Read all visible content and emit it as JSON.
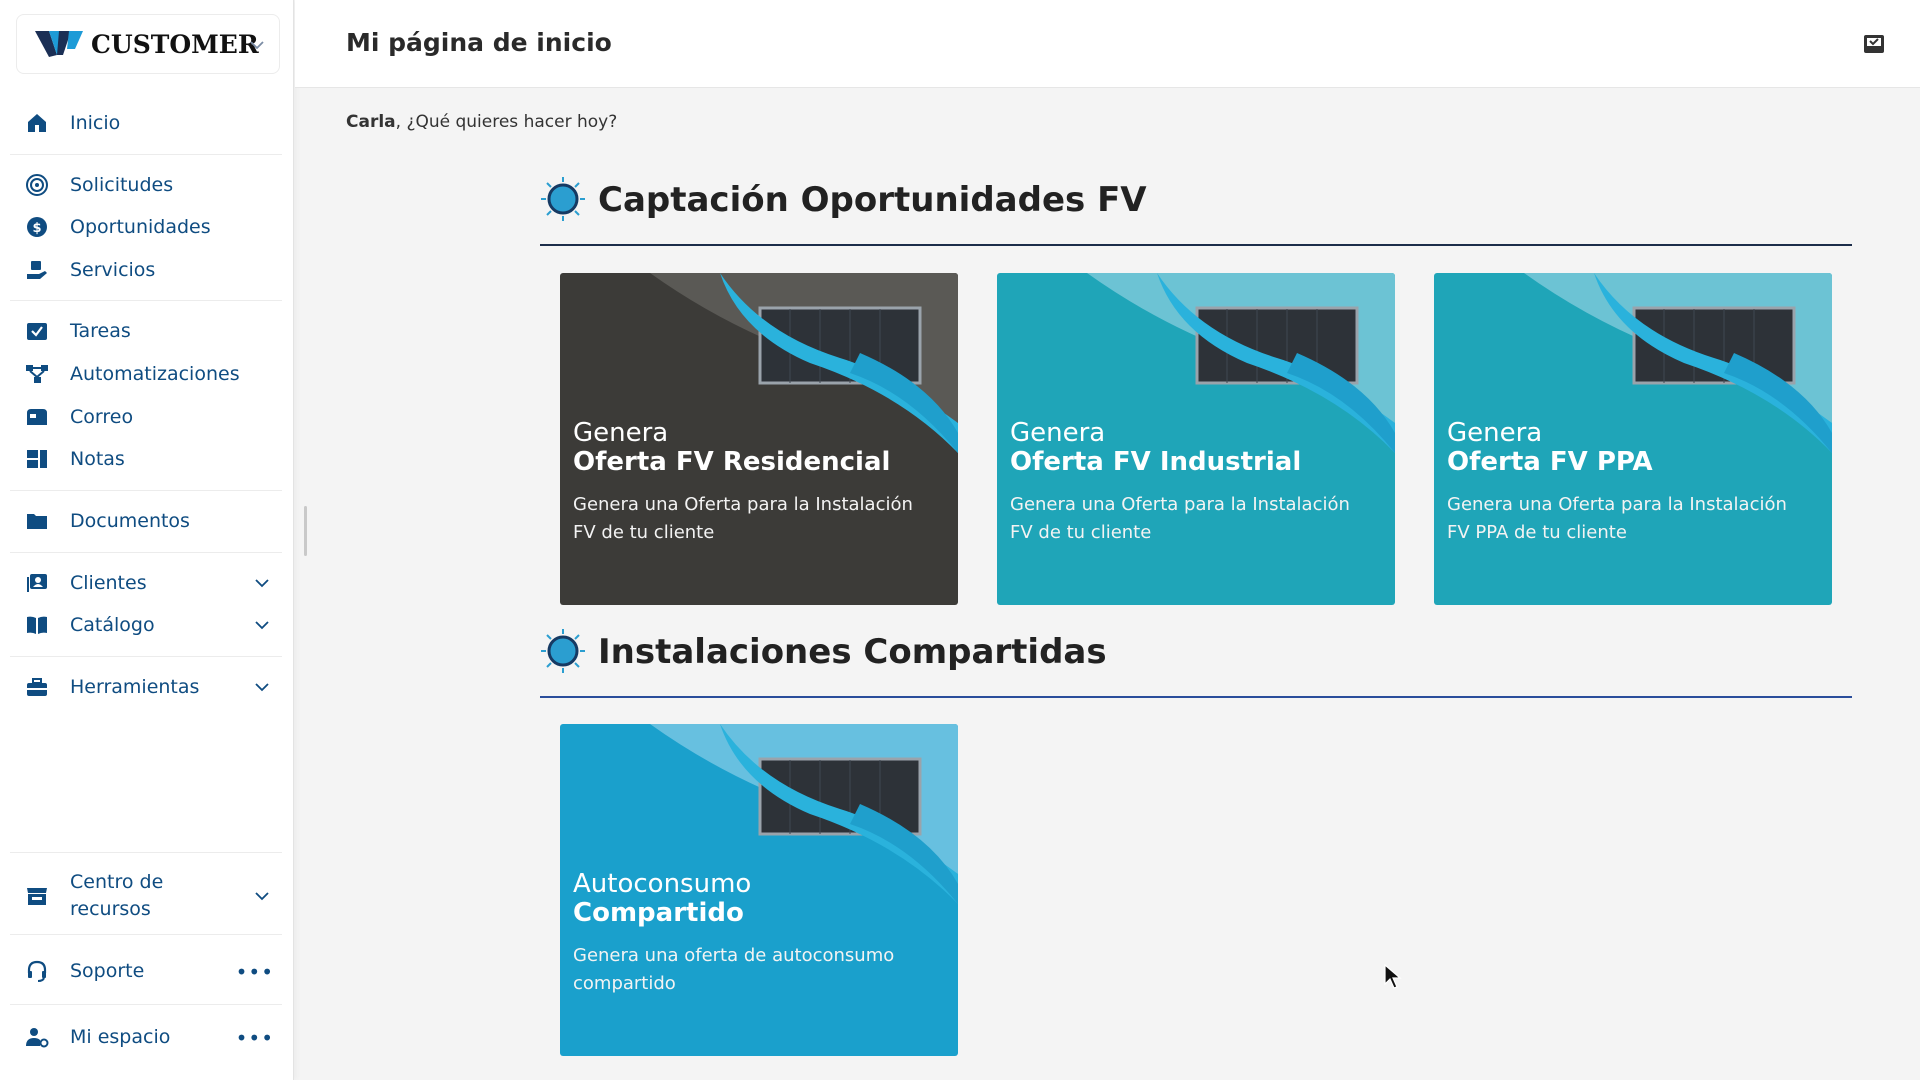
{
  "brand": {
    "name": "CUSTOMER"
  },
  "sidebar": {
    "items": [
      {
        "label": "Inicio",
        "icon": "home-icon"
      },
      {
        "label": "Solicitudes",
        "icon": "target-icon"
      },
      {
        "label": "Oportunidades",
        "icon": "dollar-icon"
      },
      {
        "label": "Servicios",
        "icon": "service-icon"
      },
      {
        "label": "Tareas",
        "icon": "tasks-icon"
      },
      {
        "label": "Automatizaciones",
        "icon": "flow-icon"
      },
      {
        "label": "Correo",
        "icon": "mail-icon"
      },
      {
        "label": "Notas",
        "icon": "notes-icon"
      },
      {
        "label": "Documentos",
        "icon": "folder-icon"
      },
      {
        "label": "Clientes",
        "icon": "clients-icon"
      },
      {
        "label": "Catálogo",
        "icon": "book-icon"
      },
      {
        "label": "Herramientas",
        "icon": "toolbox-icon"
      },
      {
        "label": "Centro de recursos",
        "icon": "store-icon"
      },
      {
        "label": "Soporte",
        "icon": "headset-icon"
      },
      {
        "label": "Mi espacio",
        "icon": "user-gear-icon"
      }
    ],
    "more_label": "•••"
  },
  "header": {
    "title": "Mi página de inicio"
  },
  "greeting": {
    "name": "Carla",
    "text": ", ¿Qué quieres hacer hoy?"
  },
  "sections": [
    {
      "title": "Captación Oportunidades FV",
      "cards": [
        {
          "title_line1": "Genera",
          "title_line2": "Oferta FV Residencial",
          "description": "Genera una Oferta para la Instalación FV de tu cliente"
        },
        {
          "title_line1": "Genera",
          "title_line2": "Oferta FV Industrial",
          "description": "Genera una Oferta para la Instalación FV de tu cliente"
        },
        {
          "title_line1": "Genera",
          "title_line2": "Oferta FV PPA",
          "description": "Genera una Oferta para la Instalación FV PPA de tu cliente"
        }
      ]
    },
    {
      "title": "Instalaciones Compartidas",
      "cards": [
        {
          "title_line1": "Autoconsumo",
          "title_line2": "Compartido",
          "description": "Genera una oferta de autoconsumo compartido"
        }
      ]
    }
  ],
  "colors": {
    "nav_text": "#0f4c81",
    "card_teal": "#1fa5b8",
    "card_blue": "#1aa0cc",
    "card_dark": "#3c3b38",
    "wave": "#2ab2dc"
  }
}
